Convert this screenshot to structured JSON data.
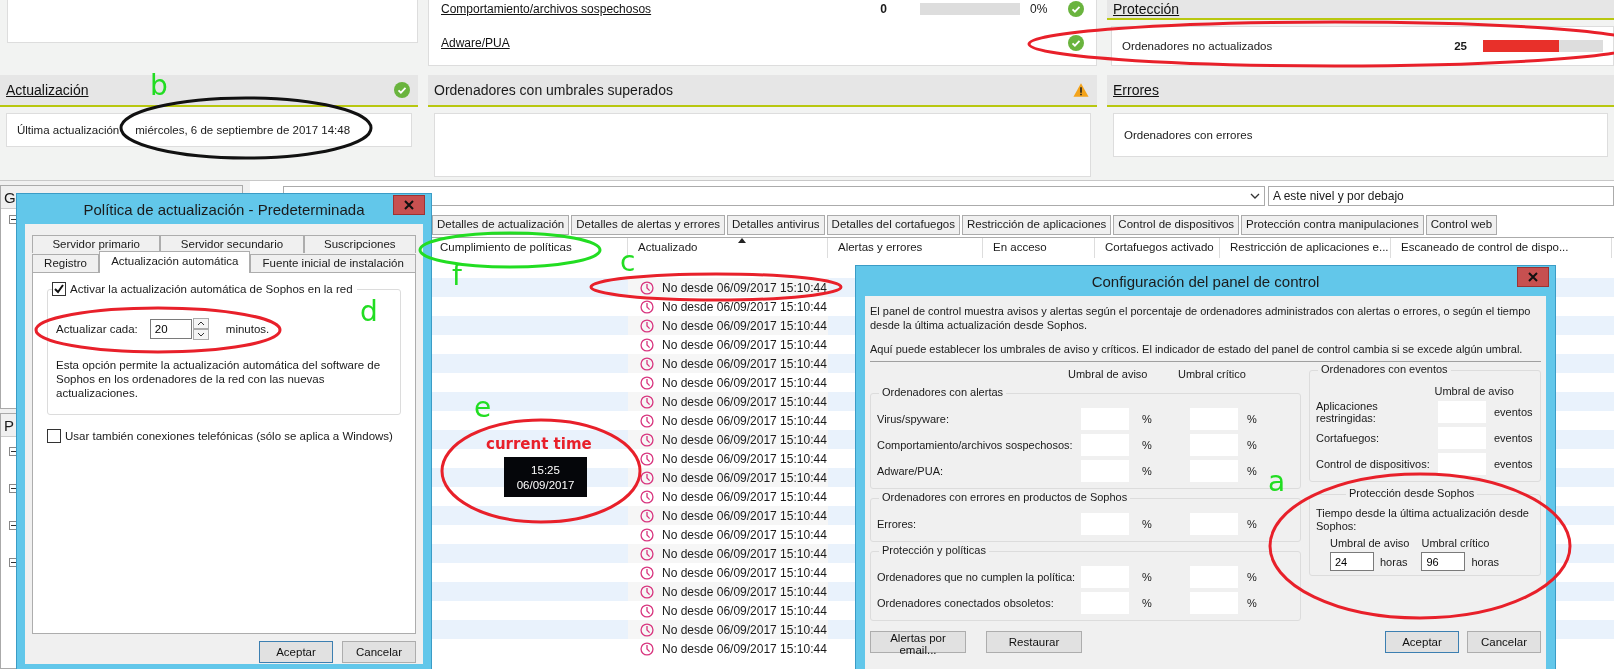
{
  "dashboard": {
    "alerts_panel": {
      "rows": [
        {
          "label": "Comportamiento/archivos sospechosos",
          "count": "0",
          "level": 0,
          "percent": "0%",
          "warning": false
        },
        {
          "label": "Adware/PUA",
          "warning": false
        }
      ]
    },
    "protection_panel": {
      "title": "Protección",
      "rows": [
        {
          "label": "Ordenadores no actualizados",
          "count": "25",
          "level": 0.63
        }
      ]
    },
    "update_panel": {
      "title": "Actualización",
      "warning": false,
      "label": "Última actualización",
      "value": "miércoles, 6 de septiembre de 2017 14:48"
    },
    "thresholds_panel": {
      "title": "Ordenadores con umbrales superados",
      "warning": true
    },
    "errors_panel": {
      "title": "Errores",
      "rows": [
        {
          "label": "Ordenadores con errores"
        }
      ]
    }
  },
  "groups_pane": {
    "title": "G"
  },
  "policies_pane": {
    "title": "P"
  },
  "filter": {
    "scope": "A este nivel y por debajo"
  },
  "tabs": [
    "Detalles de actualización",
    "Detalles de alertas y errores",
    "Detalles antivirus",
    "Detalles del cortafuegos",
    "Restricción de aplicaciones",
    "Control de dispositivos",
    "Protección contra manipulaciones",
    "Control web"
  ],
  "table": {
    "columns": [
      {
        "label": "Cumplimiento de políticas",
        "sorted": false
      },
      {
        "label": "Actualizado",
        "sorted": true
      },
      {
        "label": "Alertas y errores",
        "sorted": false
      },
      {
        "label": "En acceso",
        "sorted": false
      },
      {
        "label": "Cortafuegos activado",
        "sorted": false
      },
      {
        "label": "Restricción de aplicaciones e...",
        "sorted": false
      },
      {
        "label": "Escaneado de control de dispo...",
        "sorted": false
      }
    ],
    "rows": [
      {
        "updated": "No desde 06/09/2017 15:10:44"
      },
      {
        "updated": "No desde 06/09/2017 15:10:44"
      },
      {
        "updated": "No desde 06/09/2017 15:10:44"
      },
      {
        "updated": "No desde 06/09/2017 15:10:44"
      },
      {
        "updated": "No desde 06/09/2017 15:10:44"
      },
      {
        "updated": "No desde 06/09/2017 15:10:44"
      },
      {
        "updated": "No desde 06/09/2017 15:10:44"
      },
      {
        "updated": "No desde 06/09/2017 15:10:44"
      },
      {
        "updated": "No desde 06/09/2017 15:10:44"
      },
      {
        "updated": "No desde 06/09/2017 15:10:44"
      },
      {
        "updated": "No desde 06/09/2017 15:10:44"
      },
      {
        "updated": "No desde 06/09/2017 15:10:44"
      },
      {
        "updated": "No desde 06/09/2017 15:10:44"
      },
      {
        "updated": "No desde 06/09/2017 15:10:44"
      },
      {
        "updated": "No desde 06/09/2017 15:10:44"
      },
      {
        "updated": "No desde 06/09/2017 15:10:44"
      },
      {
        "updated": "No desde 06/09/2017 15:10:44"
      },
      {
        "updated": "No desde 06/09/2017 15:10:44"
      },
      {
        "updated": "No desde 06/09/2017 15:10:44"
      },
      {
        "updated": "No desde 06/09/2017 15:10:44"
      }
    ]
  },
  "update_policy_dialog": {
    "title": "Política de actualización - Predeterminada",
    "tab_rows": [
      [
        {
          "label": "Servidor primario",
          "selected": false
        },
        {
          "label": "Servidor secundario",
          "selected": false
        },
        {
          "label": "Suscripciones",
          "selected": false
        }
      ],
      [
        {
          "label": "Registro",
          "selected": false
        },
        {
          "label": "Actualización automática",
          "selected": true
        },
        {
          "label": "Fuente inicial de instalación",
          "selected": false
        }
      ]
    ],
    "auto_update": {
      "label": "Activar la actualización automática de Sophos en la red",
      "checked": true
    },
    "interval": {
      "label": "Actualizar cada:",
      "value": "20",
      "unit": "minutos."
    },
    "description": "Esta opción permite la actualización automática del software de Sophos en los ordenadores de la red con las nuevas actualizaciones.",
    "dialup": {
      "label": "Usar también conexiones telefónicas (sólo se aplica a Windows)",
      "checked": false
    },
    "buttons": [
      "Aceptar",
      "Cancelar"
    ]
  },
  "dashboard_config_dialog": {
    "title": "Configuración del panel de control",
    "intro": "El panel de control muestra avisos y alertas según el porcentaje de ordenadores administrados con alertas o errores, o según el tiempo desde la última actualización desde Sophos.",
    "intro_2": "Aquí puede establecer los umbrales de aviso y críticos. El indicador de estado del panel de control cambia si se excede algún umbral.",
    "warning_header": "Umbral de aviso",
    "critical_header": "Umbral crítico",
    "groups": [
      {
        "title": "Ordenadores con alertas",
        "rows": [
          {
            "label": "Virus/spyware:",
            "warning_unit": "%",
            "critical_unit": "%"
          },
          {
            "label": "Comportamiento/archivos sospechosos:",
            "warning_unit": "%",
            "critical_unit": "%"
          },
          {
            "label": "Adware/PUA:",
            "warning_unit": "%",
            "critical_unit": "%"
          }
        ]
      },
      {
        "title": "Ordenadores con errores en productos de Sophos",
        "rows": [
          {
            "label": "Errores:",
            "warning_unit": "%",
            "critical_unit": "%"
          }
        ]
      },
      {
        "title": "Protección y políticas",
        "rows": [
          {
            "label": "Ordenadores que no cumplen la política:",
            "warning_unit": "%",
            "critical_unit": "%"
          },
          {
            "label": "Ordenadores conectados obsoletos:",
            "warning_unit": "%",
            "critical_unit": "%"
          }
        ]
      }
    ],
    "events_group": {
      "title": "Ordenadores con eventos",
      "header": "Umbral de aviso",
      "rows": [
        {
          "label": "Aplicaciones restringidas:",
          "unit": "eventos"
        },
        {
          "label": "Cortafuegos:",
          "unit": "eventos"
        },
        {
          "label": "Control de dispositivos:",
          "unit": "eventos"
        }
      ]
    },
    "sophos_group": {
      "title": "Protección desde Sophos",
      "description": "Tiempo desde la última actualización desde Sophos:",
      "fields": [
        {
          "label": "Umbral de aviso",
          "value": "24",
          "unit": "horas"
        },
        {
          "label": "Umbral crítico",
          "value": "96",
          "unit": "horas"
        }
      ]
    },
    "buttons_left": [
      "Alertas por email...",
      "Restaurar"
    ],
    "buttons_right": [
      "Aceptar",
      "Cancelar"
    ]
  },
  "annotations": {
    "letters": [
      "b",
      "c",
      "d",
      "e",
      "f",
      "a"
    ],
    "current_time": {
      "label": "current time",
      "time": "15:25",
      "date": "06/09/2017"
    }
  }
}
